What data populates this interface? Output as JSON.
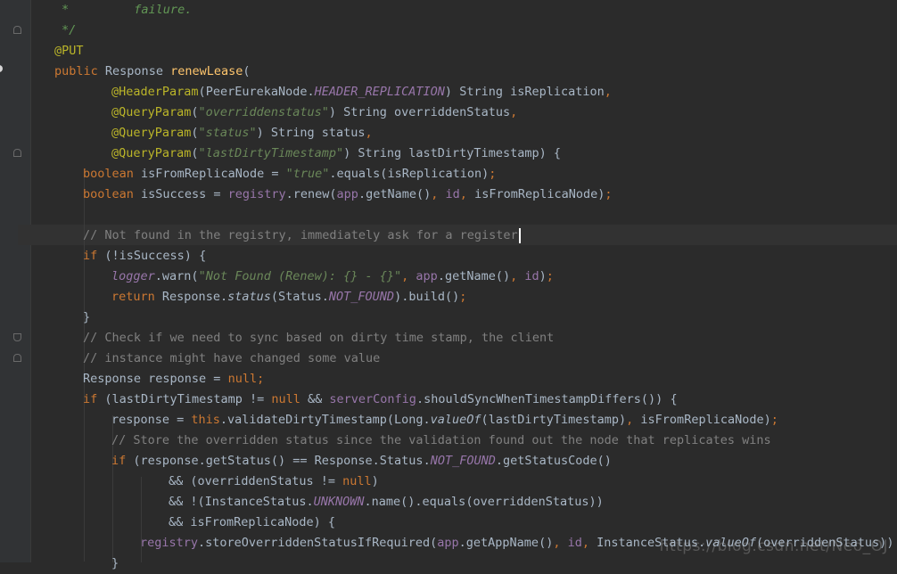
{
  "colors": {
    "background": "#2b2b2b",
    "keyword": "#cc7832",
    "annotation": "#bbb529",
    "string": "#6a8759",
    "comment": "#808080",
    "field": "#9876aa",
    "method": "#ffc66d",
    "plain": "#a9b7c6"
  },
  "code": {
    "l1": [
      "*",
      "failure."
    ],
    "l2": [
      "*/"
    ],
    "l3": [
      "@PUT"
    ],
    "l4": [
      "public",
      "Response",
      "renewLease",
      "("
    ],
    "l5": [
      "@HeaderParam",
      "(",
      "PeerEurekaNode.",
      "HEADER_REPLICATION",
      ")",
      "String isReplication",
      ","
    ],
    "l6": [
      "@QueryParam",
      "(",
      "\"overriddenstatus\"",
      ")",
      "String overriddenStatus",
      ","
    ],
    "l7": [
      "@QueryParam",
      "(",
      "\"status\"",
      ")",
      "String status",
      ","
    ],
    "l8": [
      "@QueryParam",
      "(",
      "\"lastDirtyTimestamp\"",
      ")",
      "String lastDirtyTimestamp",
      ")",
      "{"
    ],
    "l9": [
      "boolean",
      "isFromReplicaNode = ",
      "\"true\"",
      ".equals",
      "(",
      "isReplication",
      ")",
      ";"
    ],
    "l10": [
      "boolean",
      "isSuccess = ",
      "registry",
      ".renew",
      "(",
      "app",
      ".getName",
      "()",
      ",",
      "id",
      ",",
      "isFromReplicaNode",
      ")",
      ";"
    ],
    "l11": [
      "// Not found in the registry, immediately ask for a register"
    ],
    "l12": [
      "if",
      "(!isSuccess)",
      "{"
    ],
    "l13": [
      "logger",
      ".warn",
      "(",
      "\"Not Found (Renew): {} - {}\"",
      ",",
      "app",
      ".getName",
      "()",
      ",",
      "id",
      ")",
      ";"
    ],
    "l14": [
      "return",
      "Response.",
      "status",
      "(",
      "Status.",
      "NOT_FOUND",
      ")",
      ".build",
      "()",
      ";"
    ],
    "l15": [
      "}"
    ],
    "l16": [
      "// Check if we need to sync based on dirty time stamp, the client"
    ],
    "l17": [
      "// instance might have changed some value"
    ],
    "l18": [
      "Response response = ",
      "null",
      ";"
    ],
    "l19": [
      "if",
      "(lastDirtyTimestamp != ",
      "null",
      "&&",
      "serverConfig",
      ".shouldSyncWhenTimestampDiffers",
      "())",
      "{"
    ],
    "l20": [
      "response = ",
      "this",
      ".validateDirtyTimestamp",
      "(",
      "Long.",
      "valueOf",
      "(",
      "lastDirtyTimestamp",
      ")",
      ",",
      "isFromReplicaNode",
      ")",
      ";"
    ],
    "l21": [
      "// Store the overridden status since the validation found out the node that replicates wins"
    ],
    "l22": [
      "if",
      "(",
      "response.getStatus",
      "()",
      "== Response.Status.",
      "NOT_FOUND",
      ".getStatusCode",
      "()"
    ],
    "l23": [
      "&&",
      "(",
      "overriddenStatus != ",
      "null",
      ")"
    ],
    "l24": [
      "&&",
      "!(",
      "InstanceStatus.",
      "UNKNOWN",
      ".name",
      "()",
      ".equals",
      "(",
      "overriddenStatus",
      "))"
    ],
    "l25": [
      "&&",
      "isFromReplicaNode",
      ")",
      "{"
    ],
    "l26": [
      "registry",
      ".storeOverriddenStatusIfRequired",
      "(",
      "app",
      ".getAppName",
      "()",
      ",",
      "id",
      ",",
      "InstanceStatus.",
      "valueOf",
      "(",
      "overriddenStatus",
      ")",
      ")"
    ],
    "l27": [
      "}"
    ]
  },
  "watermark": "https://blog.csdn.net/Neo_OJ"
}
